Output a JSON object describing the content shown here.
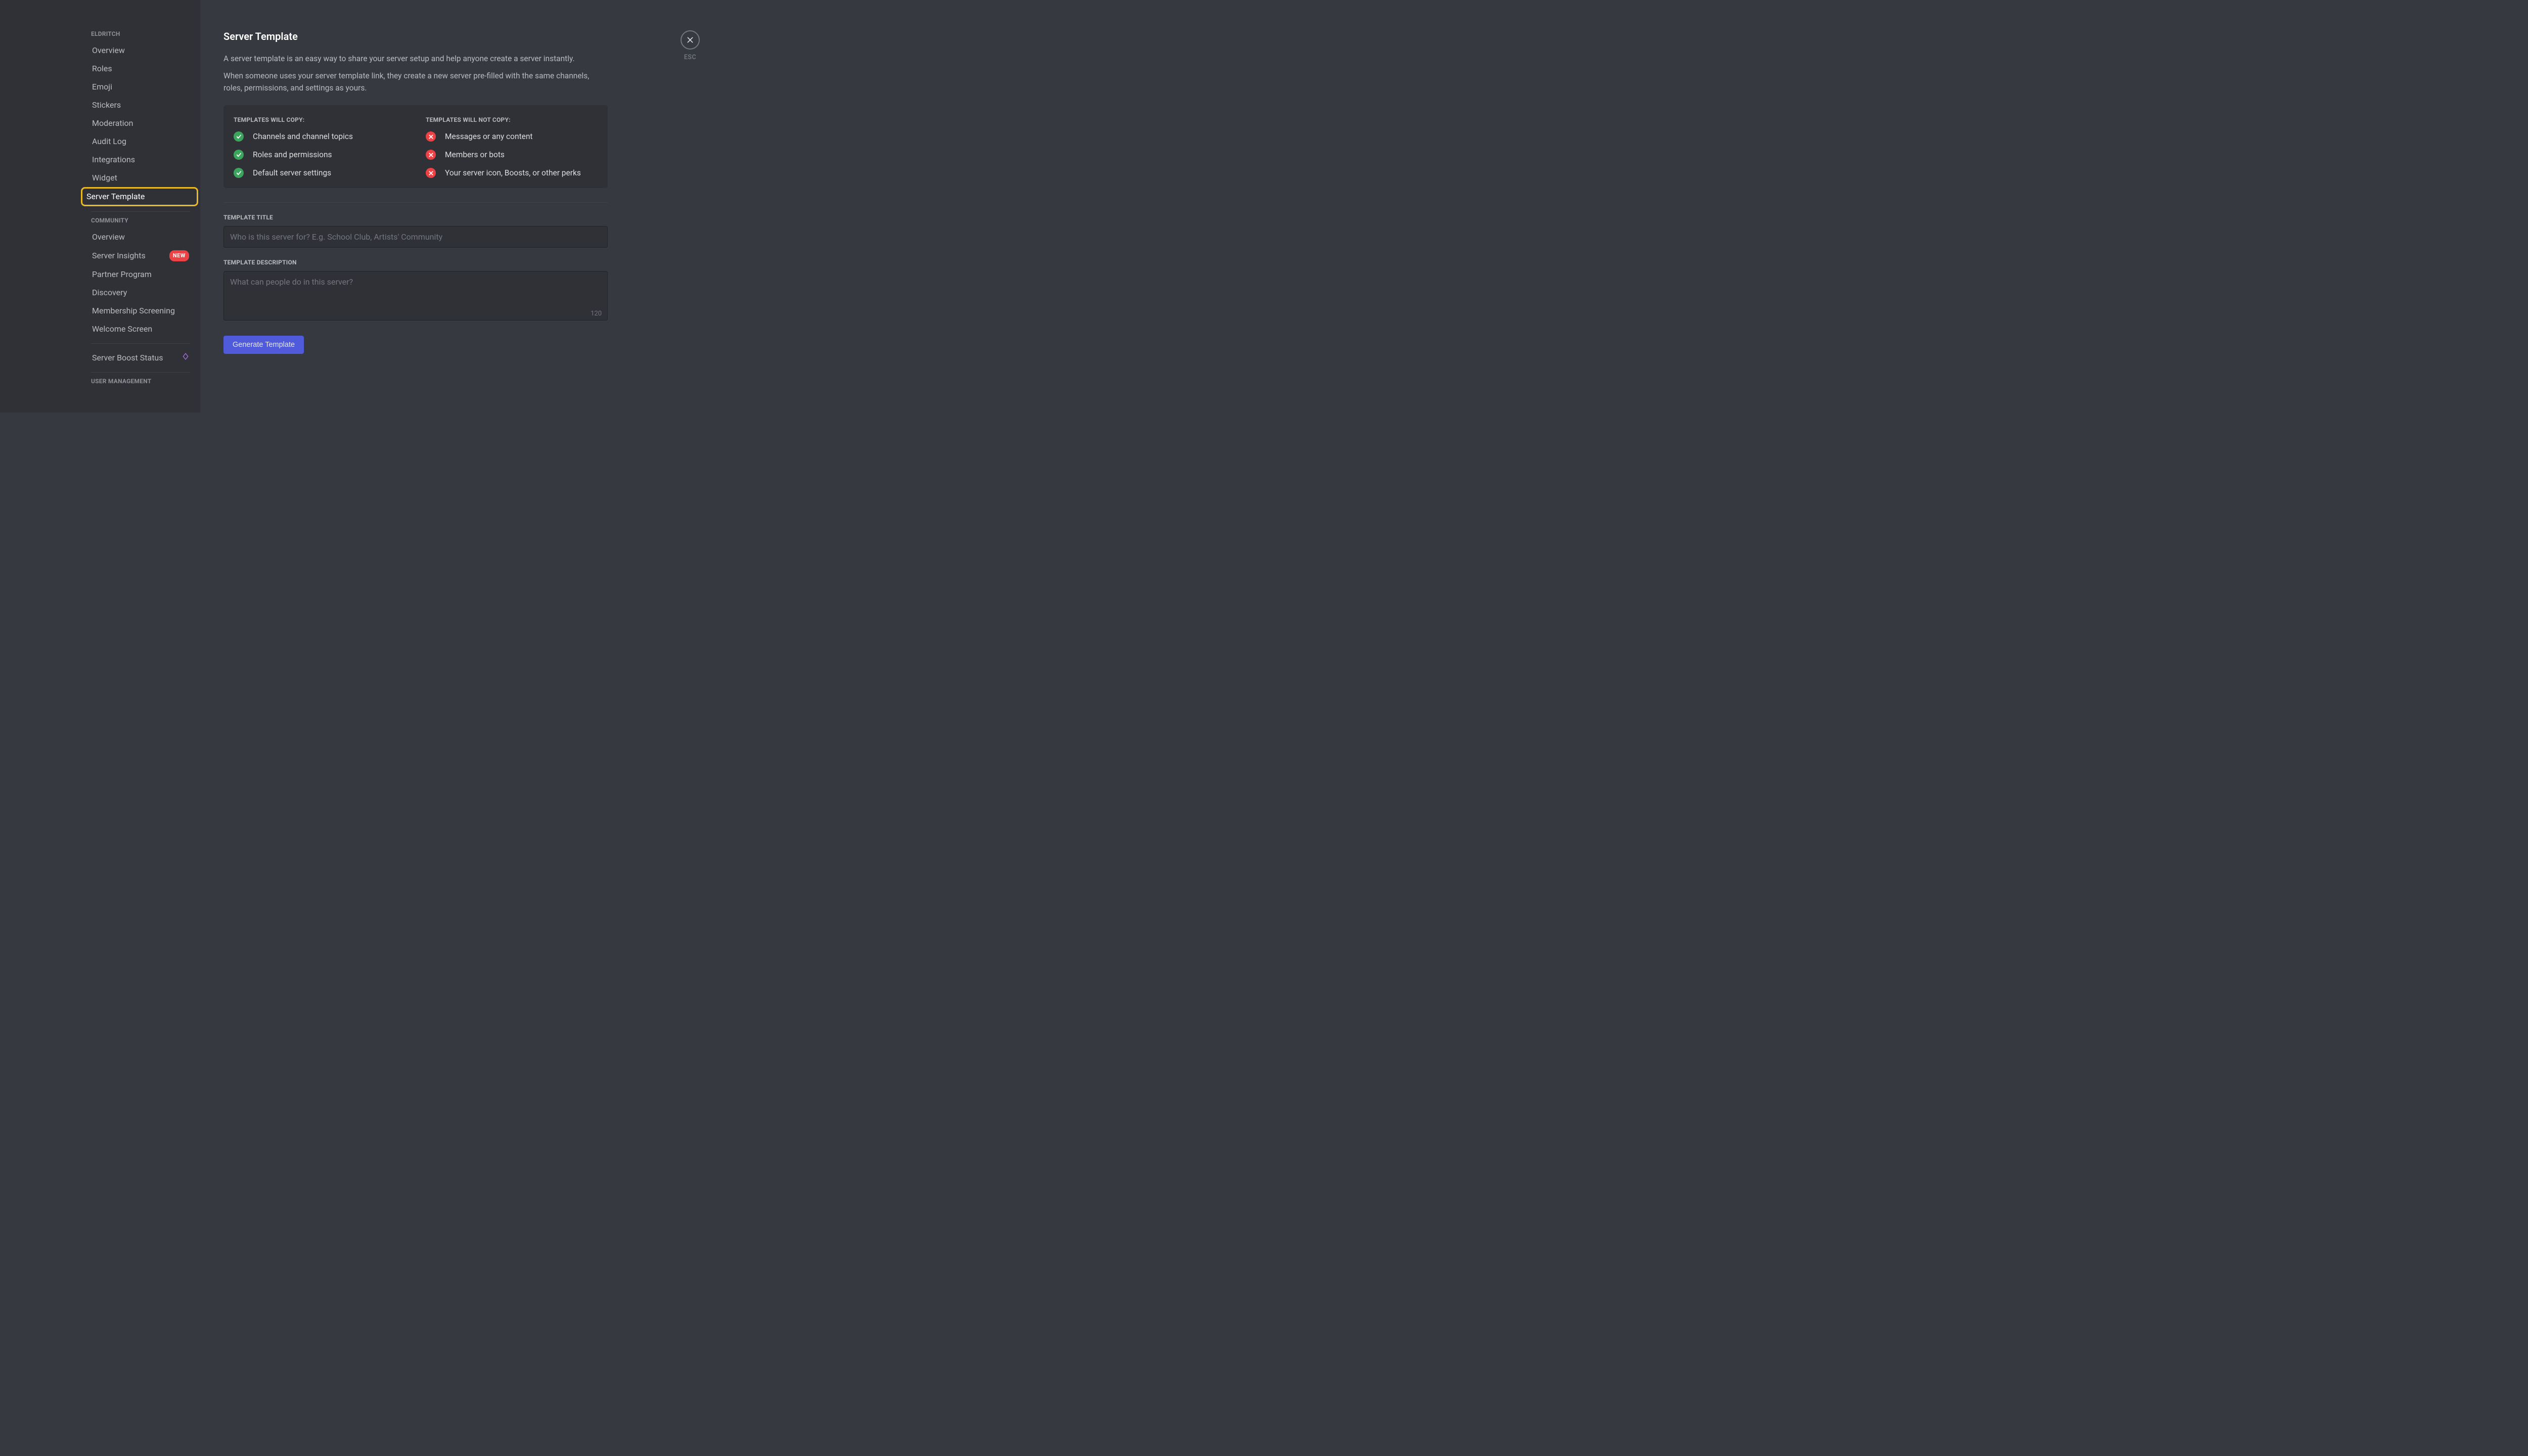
{
  "sidebar": {
    "section1": "ELDRITCH",
    "items1": [
      "Overview",
      "Roles",
      "Emoji",
      "Stickers",
      "Moderation",
      "Audit Log",
      "Integrations",
      "Widget",
      "Server Template"
    ],
    "section2": "COMMUNITY",
    "items2": [
      "Overview",
      "Server Insights",
      "Partner Program",
      "Discovery",
      "Membership Screening",
      "Welcome Screen"
    ],
    "badge_new": "NEW",
    "boost": "Server Boost Status",
    "section3": "USER MANAGEMENT"
  },
  "page": {
    "title": "Server Template",
    "desc1": "A server template is an easy way to share your server setup and help anyone create a server instantly.",
    "desc2": "When someone uses your server template link, they create a new server pre-filled with the same channels, roles, permissions, and settings as yours.",
    "copy_hdr": "TEMPLATES WILL COPY:",
    "nocopy_hdr": "TEMPLATES WILL NOT COPY:",
    "copy_items": [
      "Channels and channel topics",
      "Roles and permissions",
      "Default server settings"
    ],
    "nocopy_items": [
      "Messages or any content",
      "Members or bots",
      "Your server icon, Boosts, or other perks"
    ],
    "title_label": "TEMPLATE TITLE",
    "title_placeholder": "Who is this server for? E.g. School Club, Artists' Community",
    "desc_label": "TEMPLATE DESCRIPTION",
    "desc_placeholder": "What can people do in this server?",
    "counter": "120",
    "button": "Generate Template",
    "esc": "ESC"
  }
}
